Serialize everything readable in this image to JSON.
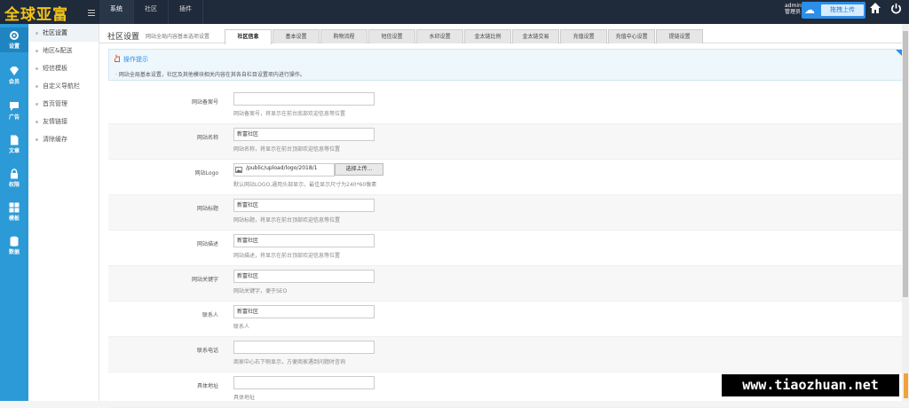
{
  "brand": {
    "logo_text": "全球亚富"
  },
  "topnav": {
    "items": [
      {
        "label": "系统",
        "active": true
      },
      {
        "label": "社区",
        "active": false
      },
      {
        "label": "插件",
        "active": false
      }
    ]
  },
  "header": {
    "admin_name": "admin",
    "admin_role": "管理员",
    "upload_button": "拖拽上传"
  },
  "leftnav": {
    "items": [
      {
        "label": "设置",
        "icon": "gear-icon",
        "active": true
      },
      {
        "label": "会员",
        "icon": "diamond-icon",
        "active": false
      },
      {
        "label": "广告",
        "icon": "message-icon",
        "active": false
      },
      {
        "label": "文章",
        "icon": "document-icon",
        "active": false
      },
      {
        "label": "权限",
        "icon": "lock-icon",
        "active": false
      },
      {
        "label": "模板",
        "icon": "grid-icon",
        "active": false
      },
      {
        "label": "数据",
        "icon": "database-icon",
        "active": false
      }
    ]
  },
  "subnav": {
    "items": [
      {
        "label": "社区设置",
        "active": true
      },
      {
        "label": "地区&配送",
        "active": false
      },
      {
        "label": "短信模板",
        "active": false
      },
      {
        "label": "自定义导航栏",
        "active": false
      },
      {
        "label": "首页管理",
        "active": false
      },
      {
        "label": "友情链接",
        "active": false
      },
      {
        "label": "清除缓存",
        "active": false
      }
    ]
  },
  "page": {
    "title": "社区设置",
    "subtitle": "网站全局内容基本选项设置"
  },
  "tabs": [
    {
      "label": "社区信息",
      "active": true
    },
    {
      "label": "基本设置",
      "active": false
    },
    {
      "label": "购物流程",
      "active": false
    },
    {
      "label": "短信设置",
      "active": false
    },
    {
      "label": "水印设置",
      "active": false
    },
    {
      "label": "金太链比例",
      "active": false
    },
    {
      "label": "金太链交易",
      "active": false
    },
    {
      "label": "充值设置",
      "active": false
    },
    {
      "label": "充值中心设置",
      "active": false
    },
    {
      "label": "提链设置",
      "active": false
    }
  ],
  "tip": {
    "title": "操作提示",
    "text": "· 网站全局基本设置，社区及其他模块相关内容在其各自栏目设置项内进行操作。"
  },
  "form": {
    "fields": [
      {
        "label": "网站备案号",
        "value": "",
        "hint": "网站备案号，将显示在前台底部欢迎信息等位置"
      },
      {
        "label": "网站名称",
        "value": "新富社区",
        "hint": "网站名称，将显示在前台顶部欢迎信息等位置"
      },
      {
        "label": "网站Logo",
        "value": "/public/upload/logo/2018/1",
        "hint": "默认网站LOGO,通用头部显示，最佳显示尺寸为240*60像素",
        "button": "选择上传..."
      },
      {
        "label": "网站标题",
        "value": "新富社区",
        "hint": "网站标题，将显示在前台顶部欢迎信息等位置"
      },
      {
        "label": "网站描述",
        "value": "新富社区",
        "hint": "网站描述，将显示在前台顶部欢迎信息等位置"
      },
      {
        "label": "网站关键字",
        "value": "新富社区",
        "hint": "网站关键字，便于SEO"
      },
      {
        "label": "联系人",
        "value": "新富社区",
        "hint": "联系人"
      },
      {
        "label": "联系电话",
        "value": "",
        "hint": "商家中心右下侧显示，方便商家遇到问题时咨询"
      },
      {
        "label": "具体地址",
        "value": "",
        "hint": "具体地址"
      }
    ]
  },
  "watermark": {
    "text": "www.tiaozhuan.net"
  }
}
